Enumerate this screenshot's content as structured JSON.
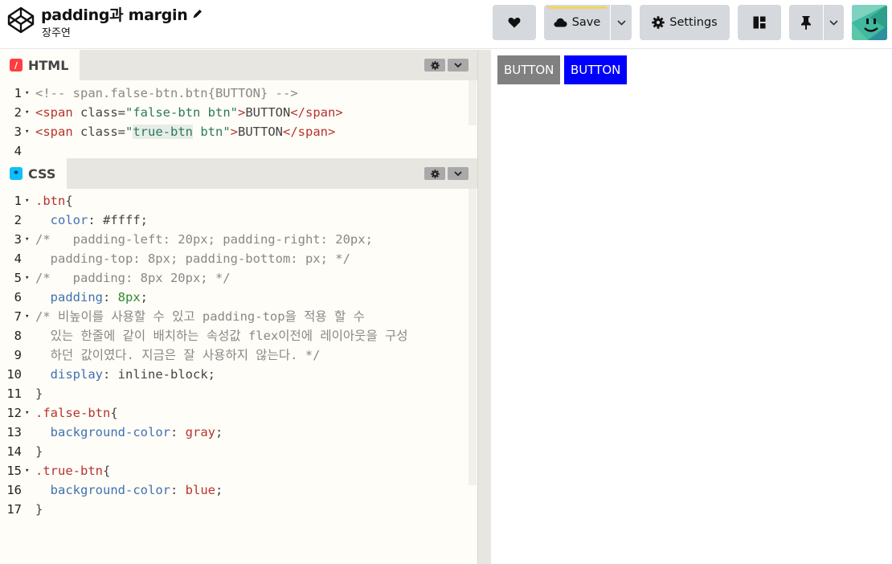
{
  "header": {
    "title": "padding과 margin",
    "author": "장주연",
    "save_label": "Save",
    "settings_label": "Settings"
  },
  "html_pane": {
    "tab_label": "HTML",
    "badge": "/",
    "lines": [
      {
        "n": "1",
        "fold": "▾",
        "segs": [
          [
            "c-comment",
            "<!-- span.false-btn.btn{BUTTON} -->"
          ]
        ]
      },
      {
        "n": "2",
        "fold": "▾",
        "segs": [
          [
            "c-tag",
            "<span"
          ],
          [
            "c-attr",
            " class="
          ],
          [
            "c-str",
            "\"false-btn btn\""
          ],
          [
            "c-tag",
            ">"
          ],
          [
            "c-val",
            "BUTTON"
          ],
          [
            "c-tag",
            "</span>"
          ]
        ]
      },
      {
        "n": "3",
        "fold": "▾",
        "segs": [
          [
            "c-tag",
            "<span"
          ],
          [
            "c-attr",
            " class="
          ],
          [
            "c-str",
            "\""
          ],
          [
            "c-str hl",
            "true-btn"
          ],
          [
            "c-str",
            " btn\""
          ],
          [
            "c-tag",
            ">"
          ],
          [
            "c-val",
            "BUTTON"
          ],
          [
            "c-tag",
            "</span>"
          ]
        ]
      },
      {
        "n": "4",
        "fold": "",
        "segs": []
      }
    ]
  },
  "css_pane": {
    "tab_label": "CSS",
    "badge": "*",
    "lines": [
      {
        "n": "1",
        "fold": "▾",
        "segs": [
          [
            "c-sel",
            ".btn"
          ],
          [
            "c-val",
            "{"
          ]
        ]
      },
      {
        "n": "2",
        "fold": "",
        "segs": [
          [
            "c-val",
            "  "
          ],
          [
            "c-prop",
            "color"
          ],
          [
            "c-val",
            ": #ffff;"
          ]
        ]
      },
      {
        "n": "3",
        "fold": "▾",
        "segs": [
          [
            "c-comment",
            "/*   padding-left: 20px; padding-right: 20px;"
          ]
        ]
      },
      {
        "n": "4",
        "fold": "",
        "segs": [
          [
            "c-comment",
            "  padding-top: 8px; padding-bottom: px; */"
          ]
        ]
      },
      {
        "n": "5",
        "fold": "▾",
        "segs": [
          [
            "c-comment",
            "/*   padding: 8px 20px; */"
          ]
        ]
      },
      {
        "n": "6",
        "fold": "",
        "segs": [
          [
            "c-val",
            "  "
          ],
          [
            "c-prop",
            "padding"
          ],
          [
            "c-val",
            ": "
          ],
          [
            "c-num",
            "8px"
          ],
          [
            "c-val",
            ";"
          ]
        ]
      },
      {
        "n": "7",
        "fold": "▾",
        "segs": [
          [
            "c-comment",
            "/* 비높이를 사용할 수 있고 padding-top을 적용 할 수"
          ]
        ]
      },
      {
        "n": "8",
        "fold": "",
        "segs": [
          [
            "c-comment",
            "  있는 한줄에 같이 배치하는 속성값 flex이전에 레이아웃을 구성"
          ]
        ]
      },
      {
        "n": "9",
        "fold": "",
        "segs": [
          [
            "c-comment",
            "  하던 값이였다. 지금은 잘 사용하지 않는다. */"
          ]
        ]
      },
      {
        "n": "10",
        "fold": "",
        "segs": [
          [
            "c-val",
            "  "
          ],
          [
            "c-prop",
            "display"
          ],
          [
            "c-val",
            ": inline-block;"
          ]
        ]
      },
      {
        "n": "11",
        "fold": "",
        "segs": [
          [
            "c-val",
            "}"
          ]
        ]
      },
      {
        "n": "12",
        "fold": "▾",
        "segs": [
          [
            "c-sel",
            ".false-btn"
          ],
          [
            "c-val",
            "{"
          ]
        ]
      },
      {
        "n": "13",
        "fold": "",
        "segs": [
          [
            "c-val",
            "  "
          ],
          [
            "c-prop",
            "background-color"
          ],
          [
            "c-val",
            ": "
          ],
          [
            "c-red",
            "gray"
          ],
          [
            "c-val",
            ";"
          ]
        ]
      },
      {
        "n": "14",
        "fold": "",
        "segs": [
          [
            "c-val",
            "}"
          ]
        ]
      },
      {
        "n": "15",
        "fold": "▾",
        "segs": [
          [
            "c-sel",
            ".true-btn"
          ],
          [
            "c-val",
            "{"
          ]
        ]
      },
      {
        "n": "16",
        "fold": "",
        "segs": [
          [
            "c-val",
            "  "
          ],
          [
            "c-prop",
            "background-color"
          ],
          [
            "c-val",
            ": "
          ],
          [
            "c-red",
            "blue"
          ],
          [
            "c-val",
            ";"
          ]
        ]
      },
      {
        "n": "17",
        "fold": "",
        "segs": [
          [
            "c-val",
            "}"
          ]
        ]
      }
    ]
  },
  "preview": {
    "buttons": [
      {
        "label": "BUTTON",
        "bg": "gray"
      },
      {
        "label": "BUTTON",
        "bg": "blue"
      }
    ]
  },
  "colors": {
    "header_button_bg": "#d5d8dc",
    "unsaved_indicator": "#f2d45c",
    "html_badge": "#ff3c41",
    "css_badge": "#0ebeff",
    "editor_bg": "#fffdf7"
  },
  "icons": {
    "logo": "codepen-logo-icon",
    "edit": "pencil-icon",
    "heart": "heart-icon",
    "save": "cloud-icon",
    "settings": "gear-icon",
    "layout": "layout-icon",
    "pin": "pin-icon",
    "dropdown": "chevron-down-icon",
    "avatar": "smiley-avatar-icon"
  }
}
